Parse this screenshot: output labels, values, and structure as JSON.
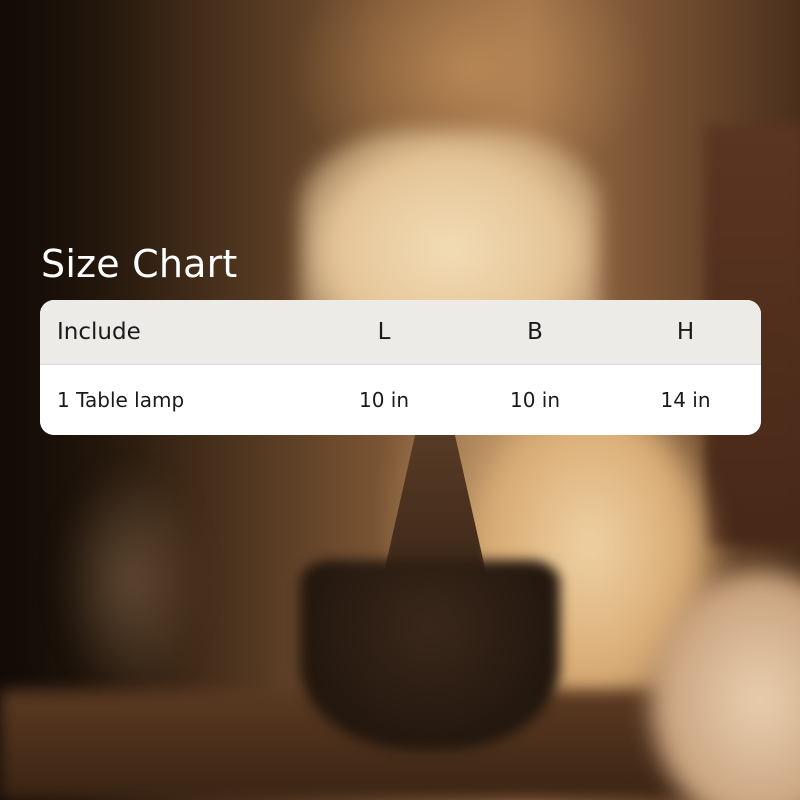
{
  "title": "Size Chart",
  "table": {
    "headers": {
      "include": "Include",
      "l": "L",
      "b": "B",
      "h": "H"
    },
    "rows": [
      {
        "include": "1 Table lamp",
        "l": "10 in",
        "b": "10 in",
        "h": "14 in"
      }
    ]
  },
  "colors": {
    "header_bg": "#ecebe8",
    "row_bg": "#ffffff",
    "title_text": "#ffffff",
    "cell_text": "#1a1a1a"
  }
}
